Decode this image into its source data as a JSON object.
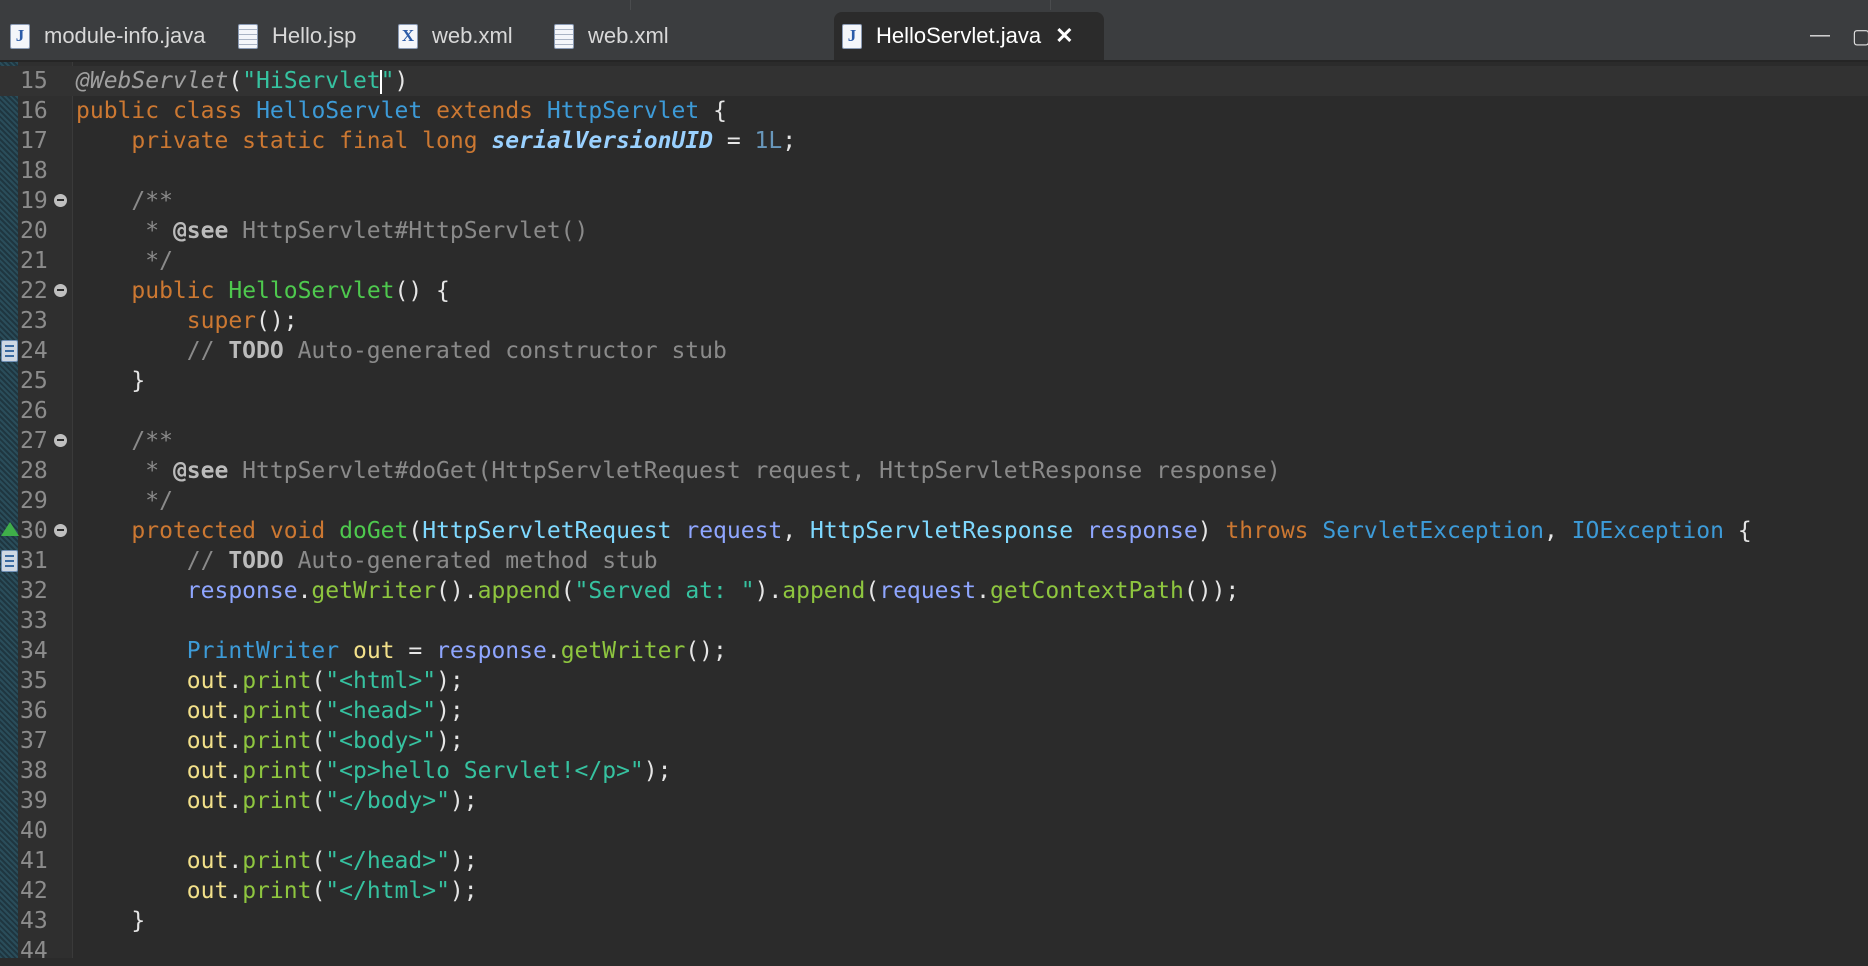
{
  "tabs": [
    {
      "label": "module-info.java",
      "icon": "java-file-icon",
      "glyph": "J",
      "active": false
    },
    {
      "label": "Hello.jsp",
      "icon": "jsp-file-icon",
      "glyph": "",
      "active": false
    },
    {
      "label": "web.xml",
      "icon": "xml-file-icon",
      "glyph": "X",
      "active": false
    },
    {
      "label": "web.xml",
      "icon": "text-file-icon",
      "glyph": "",
      "active": false
    },
    {
      "label": "HelloServlet.java",
      "icon": "java-file-icon",
      "glyph": "J",
      "active": true
    }
  ],
  "close_glyph": "✕",
  "window_controls": {
    "minimize": "—",
    "maximize": "▢"
  },
  "colors": {
    "background": "#2b2b2b",
    "keyword": "#cc7832",
    "type": "#3d9bd8",
    "method": "#8ec63f",
    "string": "#36c2a0",
    "comment": "#8a8a8a"
  },
  "editor": {
    "line_numbers": [
      "15",
      "16",
      "17",
      "18",
      "19",
      "20",
      "21",
      "22",
      "23",
      "24",
      "25",
      "26",
      "27",
      "28",
      "29",
      "30",
      "31",
      "32",
      "33",
      "34",
      "35",
      "36",
      "37",
      "38",
      "39",
      "40",
      "41",
      "42",
      "43",
      "44"
    ],
    "tokens": {
      "ann": "@WebServlet",
      "str_hi_a": "\"HiServlet",
      "str_hi_b": "\"",
      "kw_public": "public",
      "kw_class": "class",
      "cls_hello": "HelloServlet",
      "kw_extends": "extends",
      "cls_http": "HttpServlet",
      "kw_private_static_final_long": "private static final long",
      "fld_uid": "serialVersionUID",
      "num_1l": "1L",
      "cm_open": "/**",
      "cm_star": " * ",
      "tag_see": "@see",
      "cm_see1": " HttpServlet#HttpServlet()",
      "cm_close": " */",
      "ctor_hello": "HelloServlet",
      "kw_super": "super",
      "cm_slashes": "// ",
      "tag_todo": "TODO",
      "cm_ctor_stub": " Auto-generated constructor stub",
      "cm_see2": " HttpServlet#doGet(HttpServletRequest request, HttpServletResponse response)",
      "kw_protected_void": "protected void",
      "m_doget": "doGet",
      "cls_req_type": "HttpServletRequest",
      "var_request": "request",
      "cls_resp_type": "HttpServletResponse",
      "var_response": "response",
      "kw_throws": "throws",
      "cls_servletexc": "ServletException",
      "cls_ioexc": "IOException",
      "cm_method_stub": " Auto-generated method stub",
      "m_getwriter": "getWriter",
      "m_append": "append",
      "str_served": "\"Served at: \"",
      "m_getcontextpath": "getContextPath",
      "cls_printwriter": "PrintWriter",
      "local_out": "out",
      "m_print": "print",
      "str_html": "\"<html>\"",
      "str_head": "\"<head>\"",
      "str_body": "\"<body>\"",
      "str_p": "\"<p>hello Servlet!</p>\"",
      "str_body_close": "\"</body>\"",
      "str_head_close": "\"</head>\"",
      "str_html_close": "\"</html>\""
    }
  }
}
